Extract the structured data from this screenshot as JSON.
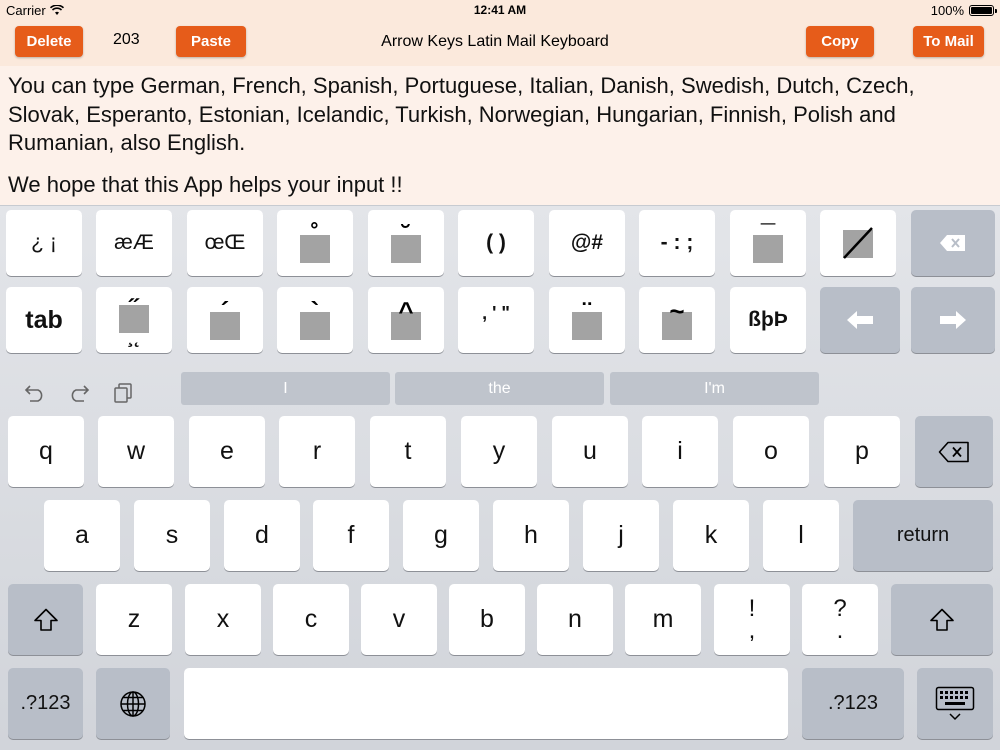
{
  "status": {
    "carrier": "Carrier",
    "time": "12:41 AM",
    "battery": "100%"
  },
  "toolbar": {
    "delete_label": "Delete",
    "counter": "203",
    "paste_label": "Paste",
    "title": "Arrow Keys Latin Mail Keyboard",
    "copy_label": "Copy",
    "to_mail_label": "To Mail",
    "accent_color": "#e65c1a"
  },
  "content": {
    "paragraph1": "You can type German, French, Spanish, Portuguese, Italian, Danish, Swedish, Dutch, Czech, Slovak, Esperanto, Estonian, Icelandic, Turkish, Norwegian, Hungarian, Finnish, Polish and Rumanian, also English.",
    "paragraph2": "We hope that this App helps your input !!"
  },
  "custom_row1": {
    "k1": "¿ ¡",
    "k2": "æÆ",
    "k3": "œŒ",
    "k4": "˚",
    "k5": "˘",
    "k6": "( )",
    "k7": "@#",
    "k8": "- : ;",
    "k9": "¯",
    "k10": "/",
    "backspace": "delete-icon"
  },
  "custom_row2": {
    "tab": "tab",
    "k2": "˝",
    "k2_sub": "¸˛",
    "k3": "´",
    "k4": "`",
    "k5": "^",
    "k6": ", ' \"",
    "k7": "¨",
    "k8": "~",
    "k9": "ßþÞ",
    "left_arrow": "left-arrow-icon",
    "right_arrow": "right-arrow-icon"
  },
  "suggestions": [
    "I",
    "the",
    "I'm"
  ],
  "rows": {
    "row1": [
      "q",
      "w",
      "e",
      "r",
      "t",
      "y",
      "u",
      "i",
      "o",
      "p"
    ],
    "row2": [
      "a",
      "s",
      "d",
      "f",
      "g",
      "h",
      "j",
      "k",
      "l"
    ],
    "row3": [
      "z",
      "x",
      "c",
      "v",
      "b",
      "n",
      "m"
    ]
  },
  "special": {
    "return": "return",
    "excl_top": "!",
    "excl_bottom": ",",
    "quest_top": "?",
    "quest_bottom": ".",
    "numbers_left": ".?123",
    "numbers_right": ".?123"
  }
}
